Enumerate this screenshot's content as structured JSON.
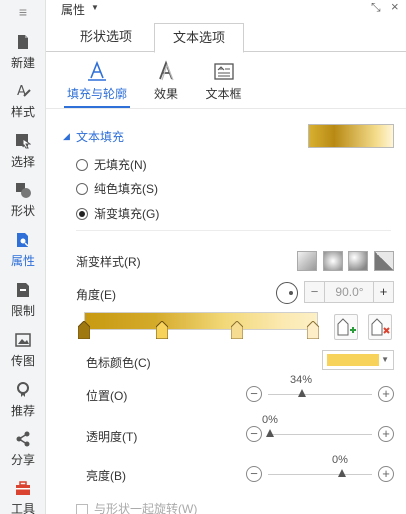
{
  "sidebar": {
    "items": [
      {
        "label": "新建"
      },
      {
        "label": "样式"
      },
      {
        "label": "选择"
      },
      {
        "label": "形状"
      },
      {
        "label": "属性"
      },
      {
        "label": "限制"
      },
      {
        "label": "传图"
      },
      {
        "label": "推荐"
      },
      {
        "label": "分享"
      },
      {
        "label": "工具"
      }
    ],
    "active": "属性"
  },
  "header": {
    "title": "属性"
  },
  "tabs": [
    {
      "label": "形状选项"
    },
    {
      "label": "文本选项"
    }
  ],
  "active_tab": "文本选项",
  "subtabs": [
    {
      "label": "填充与轮廓"
    },
    {
      "label": "效果"
    },
    {
      "label": "文本框"
    }
  ],
  "active_subtab": "填充与轮廓",
  "section": {
    "title": "文本填充"
  },
  "fill_options": [
    {
      "label": "无填充(N)",
      "checked": false
    },
    {
      "label": "纯色填充(S)",
      "checked": false
    },
    {
      "label": "渐变填充(G)",
      "checked": true
    }
  ],
  "gradient": {
    "style_label": "渐变样式(R)",
    "angle_label": "角度(E)",
    "angle_value": "90.0°",
    "stop_color_label": "色标颜色(C)",
    "stop_color": "#f7d35c",
    "position_label": "位置(O)",
    "position_value": "34%",
    "transparency_label": "透明度(T)",
    "transparency_value": "0%",
    "brightness_label": "亮度(B)",
    "brightness_value": "0%"
  },
  "rotate_with_shape": {
    "label": "与形状一起旋转(W)"
  },
  "colors": {
    "accent": "#2e6fd8",
    "gold_dark": "#c89a12",
    "gold_light": "#fdf0c6"
  }
}
